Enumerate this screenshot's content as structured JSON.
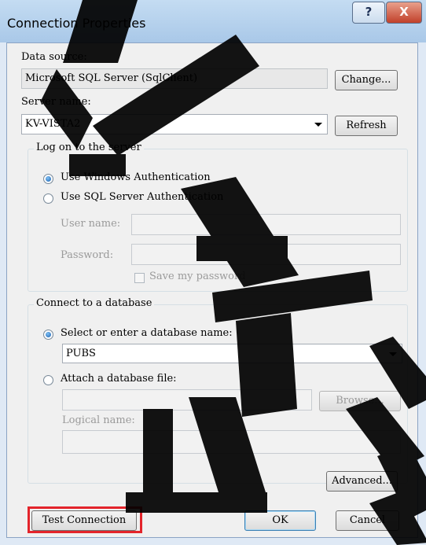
{
  "window": {
    "title": "Connection Properties",
    "help_glyph": "?",
    "close_glyph": "X"
  },
  "data_source": {
    "label": "Data source:",
    "label_accel": "s",
    "value": "Microsoft SQL Server (SqlClient)",
    "change_button": "Change..."
  },
  "server": {
    "label": "Server name:",
    "value": "KV-VISTA2",
    "refresh_button": "Refresh"
  },
  "logon": {
    "group_title": "Log on to the server",
    "windows_auth": "Use Windows Authentication",
    "sql_auth": "Use SQL Server Authentication",
    "username_label": "User name:",
    "password_label": "Password:",
    "save_password": "Save my password",
    "selected": "windows"
  },
  "database": {
    "group_title": "Connect to a database",
    "select_option": "Select or enter a database name:",
    "db_value": "PUBS",
    "attach_option": "Attach a database file:",
    "browse_button": "Browse...",
    "logical_name_label": "Logical name:",
    "selected": "select"
  },
  "buttons": {
    "advanced": "Advanced...",
    "test_connection": "Test Connection",
    "ok": "OK",
    "cancel": "Cancel"
  },
  "colors": {
    "highlight": "#e3242b",
    "watermark": "#000000"
  }
}
